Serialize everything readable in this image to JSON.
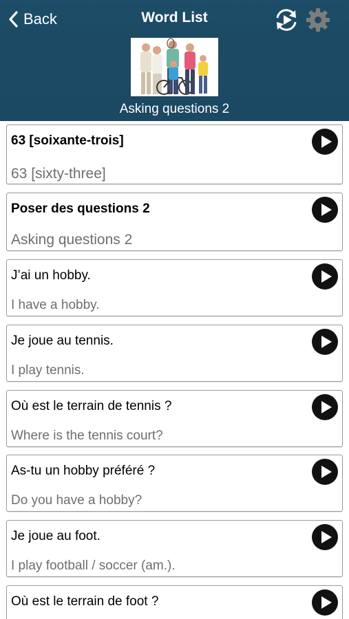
{
  "nav": {
    "back_label": "Back",
    "title": "Word List"
  },
  "lesson": {
    "title": "Asking questions 2"
  },
  "items": [
    {
      "fr": "63 [soixante-trois]",
      "en": "63 [sixty-three]",
      "bold": true
    },
    {
      "fr": "Poser des questions 2",
      "en": "Asking questions 2",
      "bold": true
    },
    {
      "fr": "J’ai un hobby.",
      "en": "I have a hobby.",
      "bold": false
    },
    {
      "fr": "Je joue au tennis.",
      "en": "I play tennis.",
      "bold": false
    },
    {
      "fr": "Où est le terrain de tennis ?",
      "en": "Where is the tennis court?",
      "bold": false
    },
    {
      "fr": "As-tu un hobby préféré ?",
      "en": "Do you have a hobby?",
      "bold": false
    },
    {
      "fr": "Je joue au foot.",
      "en": "I play football / soccer (am.).",
      "bold": false
    },
    {
      "fr": "Où est le terrain de foot ?",
      "en": "",
      "bold": false
    }
  ],
  "icons": {
    "back": "chevron-left-icon",
    "refresh": "refresh-play-icon",
    "settings": "gear-icon",
    "play": "play-icon"
  },
  "colors": {
    "header_bg": "#1c4a64",
    "card_border": "#9a9a9a",
    "secondary_text": "#6e6e6e",
    "play_button": "#111111"
  }
}
